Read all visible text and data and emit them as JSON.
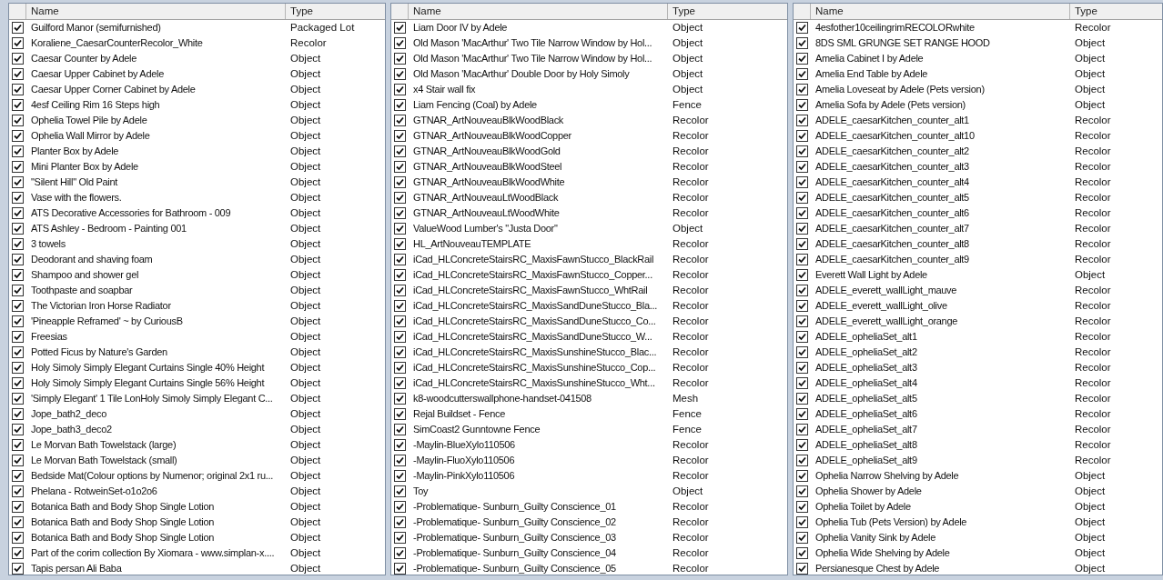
{
  "panels": [
    {
      "columns": [
        "Name",
        "Type"
      ],
      "rows": [
        {
          "checked": true,
          "name": "Guilford Manor (semifurnished)",
          "type": "Packaged Lot"
        },
        {
          "checked": true,
          "name": "Koraliene_CaesarCounterRecolor_White",
          "type": "Recolor"
        },
        {
          "checked": true,
          "name": "Caesar Counter by Adele",
          "type": "Object"
        },
        {
          "checked": true,
          "name": "Caesar Upper Cabinet by Adele",
          "type": "Object"
        },
        {
          "checked": true,
          "name": "Caesar Upper Corner Cabinet by Adele",
          "type": "Object"
        },
        {
          "checked": true,
          "name": "4esf Ceiling Rim 16 Steps high",
          "type": "Object"
        },
        {
          "checked": true,
          "name": "Ophelia Towel Pile by Adele",
          "type": "Object"
        },
        {
          "checked": true,
          "name": "Ophelia Wall Mirror by Adele",
          "type": "Object"
        },
        {
          "checked": true,
          "name": "Planter Box by Adele",
          "type": "Object"
        },
        {
          "checked": true,
          "name": "Mini Planter Box by Adele",
          "type": "Object"
        },
        {
          "checked": true,
          "name": "\"Silent Hill\" Old Paint",
          "type": "Object"
        },
        {
          "checked": true,
          "name": "Vase with the flowers.",
          "type": "Object"
        },
        {
          "checked": true,
          "name": "ATS Decorative Accessories for Bathroom - 009",
          "type": "Object"
        },
        {
          "checked": true,
          "name": "ATS Ashley - Bedroom - Painting 001",
          "type": "Object"
        },
        {
          "checked": true,
          "name": "3 towels",
          "type": "Object"
        },
        {
          "checked": true,
          "name": "Deodorant and shaving foam",
          "type": "Object"
        },
        {
          "checked": true,
          "name": "Shampoo and shower gel",
          "type": "Object"
        },
        {
          "checked": true,
          "name": "Toothpaste and soapbar",
          "type": "Object"
        },
        {
          "checked": true,
          "name": "The Victorian Iron Horse Radiator",
          "type": "Object"
        },
        {
          "checked": true,
          "name": "'Pineapple Reframed' ~ by CuriousB",
          "type": "Object"
        },
        {
          "checked": true,
          "name": "Freesias",
          "type": "Object"
        },
        {
          "checked": true,
          "name": "Potted Ficus by Nature's Garden",
          "type": "Object"
        },
        {
          "checked": true,
          "name": "Holy Simoly Simply Elegant Curtains Single 40% Height",
          "type": "Object"
        },
        {
          "checked": true,
          "name": "Holy Simoly Simply Elegant Curtains Single 56% Height",
          "type": "Object"
        },
        {
          "checked": true,
          "name": "'Simply Elegant' 1 Tile LonHoly Simoly Simply Elegant C...",
          "type": "Object"
        },
        {
          "checked": true,
          "name": "Jope_bath2_deco",
          "type": "Object"
        },
        {
          "checked": true,
          "name": "Jope_bath3_deco2",
          "type": "Object"
        },
        {
          "checked": true,
          "name": "Le Morvan Bath Towelstack (large)",
          "type": "Object"
        },
        {
          "checked": true,
          "name": "Le Morvan Bath Towelstack (small)",
          "type": "Object"
        },
        {
          "checked": true,
          "name": "Bedside Mat(Colour options by Numenor; original 2x1 ru...",
          "type": "Object"
        },
        {
          "checked": true,
          "name": "Phelana - RotweinSet-o1o2o6",
          "type": "Object"
        },
        {
          "checked": true,
          "name": "Botanica Bath and Body Shop Single Lotion",
          "type": "Object"
        },
        {
          "checked": true,
          "name": "Botanica Bath and Body Shop Single Lotion",
          "type": "Object"
        },
        {
          "checked": true,
          "name": "Botanica Bath and Body Shop Single Lotion",
          "type": "Object"
        },
        {
          "checked": true,
          "name": "Part of the corim collection By Xiomara - www.simplan-x....",
          "type": "Object"
        },
        {
          "checked": true,
          "name": "Tapis persan Ali Baba",
          "type": "Object"
        }
      ]
    },
    {
      "columns": [
        "Name",
        "Type"
      ],
      "rows": [
        {
          "checked": true,
          "name": "Liam Door IV by Adele",
          "type": "Object"
        },
        {
          "checked": true,
          "name": "Old Mason 'MacArthur' Two Tile Narrow Window by Hol...",
          "type": "Object"
        },
        {
          "checked": true,
          "name": "Old Mason 'MacArthur' Two Tile Narrow Window by Hol...",
          "type": "Object"
        },
        {
          "checked": true,
          "name": "Old Mason 'MacArthur' Double Door by Holy Simoly",
          "type": "Object"
        },
        {
          "checked": true,
          "name": "x4 Stair wall fix",
          "type": "Object"
        },
        {
          "checked": true,
          "name": "Liam Fencing (Coal) by Adele",
          "type": "Fence"
        },
        {
          "checked": true,
          "name": "GTNAR_ArtNouveauBlkWoodBlack",
          "type": "Recolor"
        },
        {
          "checked": true,
          "name": "GTNAR_ArtNouveauBlkWoodCopper",
          "type": "Recolor"
        },
        {
          "checked": true,
          "name": "GTNAR_ArtNouveauBlkWoodGold",
          "type": "Recolor"
        },
        {
          "checked": true,
          "name": "GTNAR_ArtNouveauBlkWoodSteel",
          "type": "Recolor"
        },
        {
          "checked": true,
          "name": "GTNAR_ArtNouveauBlkWoodWhite",
          "type": "Recolor"
        },
        {
          "checked": true,
          "name": "GTNAR_ArtNouveauLtWoodBlack",
          "type": "Recolor"
        },
        {
          "checked": true,
          "name": "GTNAR_ArtNouveauLtWoodWhite",
          "type": "Recolor"
        },
        {
          "checked": true,
          "name": "ValueWood Lumber's \"Justa Door\"",
          "type": "Object"
        },
        {
          "checked": true,
          "name": "HL_ArtNouveauTEMPLATE",
          "type": "Recolor"
        },
        {
          "checked": true,
          "name": "iCad_HLConcreteStairsRC_MaxisFawnStucco_BlackRail",
          "type": "Recolor"
        },
        {
          "checked": true,
          "name": "iCad_HLConcreteStairsRC_MaxisFawnStucco_Copper...",
          "type": "Recolor"
        },
        {
          "checked": true,
          "name": "iCad_HLConcreteStairsRC_MaxisFawnStucco_WhtRail",
          "type": "Recolor"
        },
        {
          "checked": true,
          "name": "iCad_HLConcreteStairsRC_MaxisSandDuneStucco_Bla...",
          "type": "Recolor"
        },
        {
          "checked": true,
          "name": "iCad_HLConcreteStairsRC_MaxisSandDuneStucco_Co...",
          "type": "Recolor"
        },
        {
          "checked": true,
          "name": "iCad_HLConcreteStairsRC_MaxisSandDuneStucco_W...",
          "type": "Recolor"
        },
        {
          "checked": true,
          "name": "iCad_HLConcreteStairsRC_MaxisSunshineStucco_Blac...",
          "type": "Recolor"
        },
        {
          "checked": true,
          "name": "iCad_HLConcreteStairsRC_MaxisSunshineStucco_Cop...",
          "type": "Recolor"
        },
        {
          "checked": true,
          "name": "iCad_HLConcreteStairsRC_MaxisSunshineStucco_Wht...",
          "type": "Recolor"
        },
        {
          "checked": true,
          "name": "k8-woodcutterswallphone-handset-041508",
          "type": "Mesh"
        },
        {
          "checked": true,
          "name": "Rejal Buildset - Fence",
          "type": "Fence"
        },
        {
          "checked": true,
          "name": "SimCoast2 Gunntowne Fence",
          "type": "Fence"
        },
        {
          "checked": true,
          "name": "-Maylin-BlueXylo110506",
          "type": "Recolor"
        },
        {
          "checked": true,
          "name": "-Maylin-FluoXylo110506",
          "type": "Recolor"
        },
        {
          "checked": true,
          "name": "-Maylin-PinkXylo110506",
          "type": "Recolor"
        },
        {
          "checked": true,
          "name": "Toy",
          "type": "Object"
        },
        {
          "checked": true,
          "name": "-Problematique- Sunburn_Guilty Conscience_01",
          "type": "Recolor"
        },
        {
          "checked": true,
          "name": "-Problematique- Sunburn_Guilty Conscience_02",
          "type": "Recolor"
        },
        {
          "checked": true,
          "name": "-Problematique- Sunburn_Guilty Conscience_03",
          "type": "Recolor"
        },
        {
          "checked": true,
          "name": "-Problematique- Sunburn_Guilty Conscience_04",
          "type": "Recolor"
        },
        {
          "checked": true,
          "name": "-Problematique- Sunburn_Guilty Conscience_05",
          "type": "Recolor"
        }
      ]
    },
    {
      "columns": [
        "Name",
        "Type"
      ],
      "rows": [
        {
          "checked": true,
          "name": "4esfother10ceilingrimRECOLORwhite",
          "type": "Recolor"
        },
        {
          "checked": true,
          "name": "8DS SML GRUNGE SET RANGE HOOD",
          "type": "Object"
        },
        {
          "checked": true,
          "name": "Amelia Cabinet I by Adele",
          "type": "Object"
        },
        {
          "checked": true,
          "name": "Amelia End Table by Adele",
          "type": "Object"
        },
        {
          "checked": true,
          "name": "Amelia Loveseat by Adele (Pets version)",
          "type": "Object"
        },
        {
          "checked": true,
          "name": "Amelia Sofa by Adele (Pets version)",
          "type": "Object"
        },
        {
          "checked": true,
          "name": "ADELE_caesarKitchen_counter_alt1",
          "type": "Recolor"
        },
        {
          "checked": true,
          "name": "ADELE_caesarKitchen_counter_alt10",
          "type": "Recolor"
        },
        {
          "checked": true,
          "name": "ADELE_caesarKitchen_counter_alt2",
          "type": "Recolor"
        },
        {
          "checked": true,
          "name": "ADELE_caesarKitchen_counter_alt3",
          "type": "Recolor"
        },
        {
          "checked": true,
          "name": "ADELE_caesarKitchen_counter_alt4",
          "type": "Recolor"
        },
        {
          "checked": true,
          "name": "ADELE_caesarKitchen_counter_alt5",
          "type": "Recolor"
        },
        {
          "checked": true,
          "name": "ADELE_caesarKitchen_counter_alt6",
          "type": "Recolor"
        },
        {
          "checked": true,
          "name": "ADELE_caesarKitchen_counter_alt7",
          "type": "Recolor"
        },
        {
          "checked": true,
          "name": "ADELE_caesarKitchen_counter_alt8",
          "type": "Recolor"
        },
        {
          "checked": true,
          "name": "ADELE_caesarKitchen_counter_alt9",
          "type": "Recolor"
        },
        {
          "checked": true,
          "name": "Everett Wall Light by Adele",
          "type": "Object"
        },
        {
          "checked": true,
          "name": "ADELE_everett_wallLight_mauve",
          "type": "Recolor"
        },
        {
          "checked": true,
          "name": "ADELE_everett_wallLight_olive",
          "type": "Recolor"
        },
        {
          "checked": true,
          "name": "ADELE_everett_wallLight_orange",
          "type": "Recolor"
        },
        {
          "checked": true,
          "name": "ADELE_opheliaSet_alt1",
          "type": "Recolor"
        },
        {
          "checked": true,
          "name": "ADELE_opheliaSet_alt2",
          "type": "Recolor"
        },
        {
          "checked": true,
          "name": "ADELE_opheliaSet_alt3",
          "type": "Recolor"
        },
        {
          "checked": true,
          "name": "ADELE_opheliaSet_alt4",
          "type": "Recolor"
        },
        {
          "checked": true,
          "name": "ADELE_opheliaSet_alt5",
          "type": "Recolor"
        },
        {
          "checked": true,
          "name": "ADELE_opheliaSet_alt6",
          "type": "Recolor"
        },
        {
          "checked": true,
          "name": "ADELE_opheliaSet_alt7",
          "type": "Recolor"
        },
        {
          "checked": true,
          "name": "ADELE_opheliaSet_alt8",
          "type": "Recolor"
        },
        {
          "checked": true,
          "name": "ADELE_opheliaSet_alt9",
          "type": "Recolor"
        },
        {
          "checked": true,
          "name": "Ophelia Narrow Shelving by Adele",
          "type": "Object"
        },
        {
          "checked": true,
          "name": "Ophelia Shower by Adele",
          "type": "Object"
        },
        {
          "checked": true,
          "name": "Ophelia Toilet by Adele",
          "type": "Object"
        },
        {
          "checked": true,
          "name": "Ophelia Tub (Pets Version) by Adele",
          "type": "Object"
        },
        {
          "checked": true,
          "name": "Ophelia Vanity Sink by Adele",
          "type": "Object"
        },
        {
          "checked": true,
          "name": "Ophelia Wide Shelving by Adele",
          "type": "Object"
        },
        {
          "checked": true,
          "name": "Persianesque Chest by Adele",
          "type": "Object"
        }
      ]
    }
  ]
}
